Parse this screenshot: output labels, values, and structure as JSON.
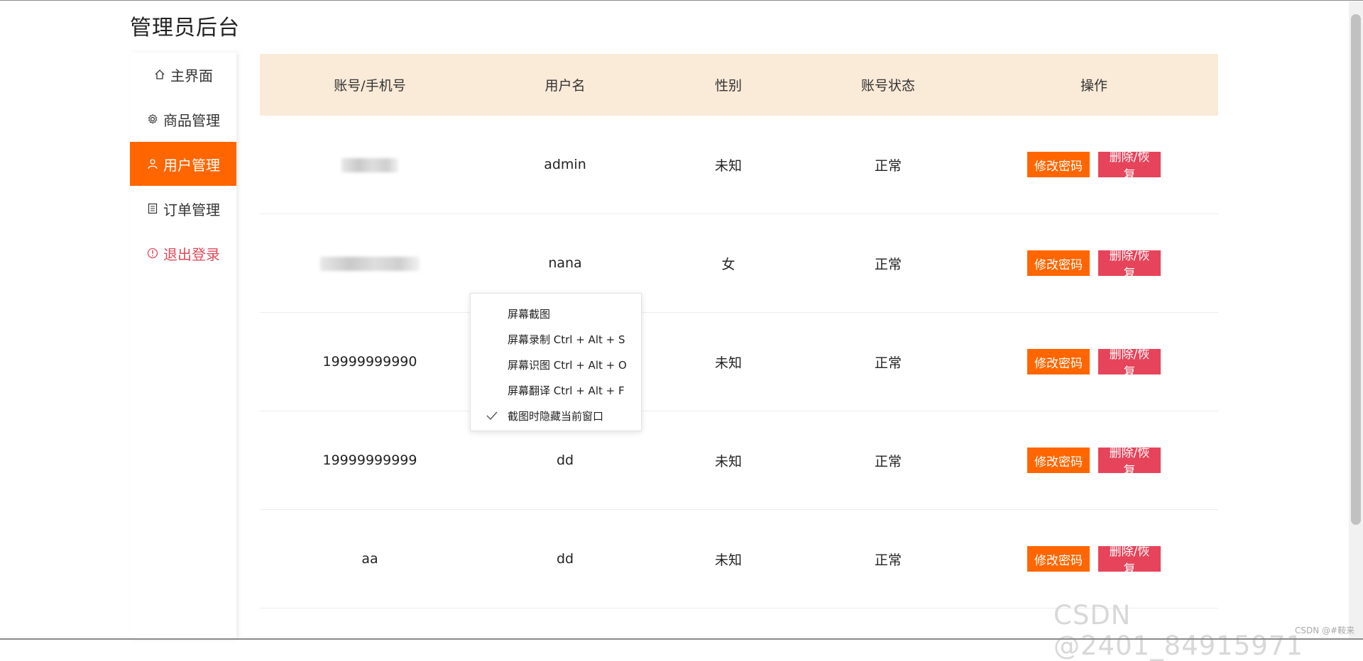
{
  "app": {
    "title": "管理员后台"
  },
  "sidebar": {
    "items": [
      {
        "label": "主界面",
        "icon": "home-icon",
        "active": false
      },
      {
        "label": "商品管理",
        "icon": "gear-icon",
        "active": false
      },
      {
        "label": "用户管理",
        "icon": "user-icon",
        "active": true
      },
      {
        "label": "订单管理",
        "icon": "document-icon",
        "active": false
      },
      {
        "label": "退出登录",
        "icon": "warning-icon",
        "active": false
      }
    ]
  },
  "table": {
    "headers": [
      "账号/手机号",
      "用户名",
      "性别",
      "账号状态",
      "操作"
    ],
    "rows": [
      {
        "account": "",
        "username": "admin",
        "gender": "未知",
        "status": "正常"
      },
      {
        "account": "",
        "username": "nana",
        "gender": "女",
        "status": "正常"
      },
      {
        "account": "19999999990",
        "username": "",
        "gender": "未知",
        "status": "正常"
      },
      {
        "account": "19999999999",
        "username": "dd",
        "gender": "未知",
        "status": "正常"
      },
      {
        "account": "aa",
        "username": "dd",
        "gender": "未知",
        "status": "正常"
      }
    ],
    "actions": {
      "edit_label": "修改密码",
      "delete_label": "删除/恢复"
    }
  },
  "context_menu": {
    "items": [
      {
        "label": "屏幕截图",
        "checked": false
      },
      {
        "label": "屏幕录制 Ctrl + Alt + S",
        "checked": false
      },
      {
        "label": "屏幕识图 Ctrl + Alt + O",
        "checked": false
      },
      {
        "label": "屏幕翻译 Ctrl + Alt + F",
        "checked": false
      },
      {
        "label": "截图时隐藏当前窗口",
        "checked": true
      }
    ]
  },
  "watermark": {
    "text": "CSDN @2401_84915971",
    "small": "CSDN @#鞍来"
  },
  "colors": {
    "accent": "#ff6600",
    "danger": "#e6445a",
    "header_bg": "#faead8"
  }
}
